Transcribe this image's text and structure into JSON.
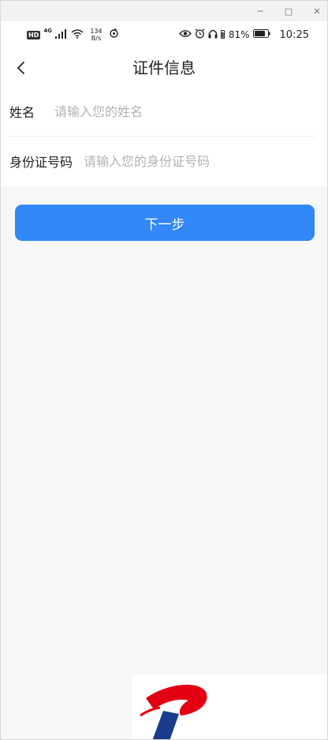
{
  "window": {
    "minimize_icon": "minimize-icon",
    "maximize_icon": "maximize-icon",
    "close_icon": "close-icon",
    "minimize_glyph": "─",
    "maximize_glyph": "□",
    "close_glyph": "✕"
  },
  "status_bar": {
    "hd": "HD",
    "network": "4G",
    "speed_value": "134",
    "speed_unit": "B/s",
    "battery": "81%",
    "time": "10:25"
  },
  "header": {
    "title": "证件信息",
    "back_icon": "chevron-left-icon"
  },
  "form": {
    "name_label": "姓名",
    "name_placeholder": "请输入您的姓名",
    "name_value": "",
    "id_label": "身份证号码",
    "id_placeholder": "请输入您的身份证号码",
    "id_value": ""
  },
  "actions": {
    "next_label": "下一步"
  },
  "colors": {
    "primary": "#3188f8",
    "logo_red": "#e30012",
    "logo_blue": "#1a3c8c"
  }
}
